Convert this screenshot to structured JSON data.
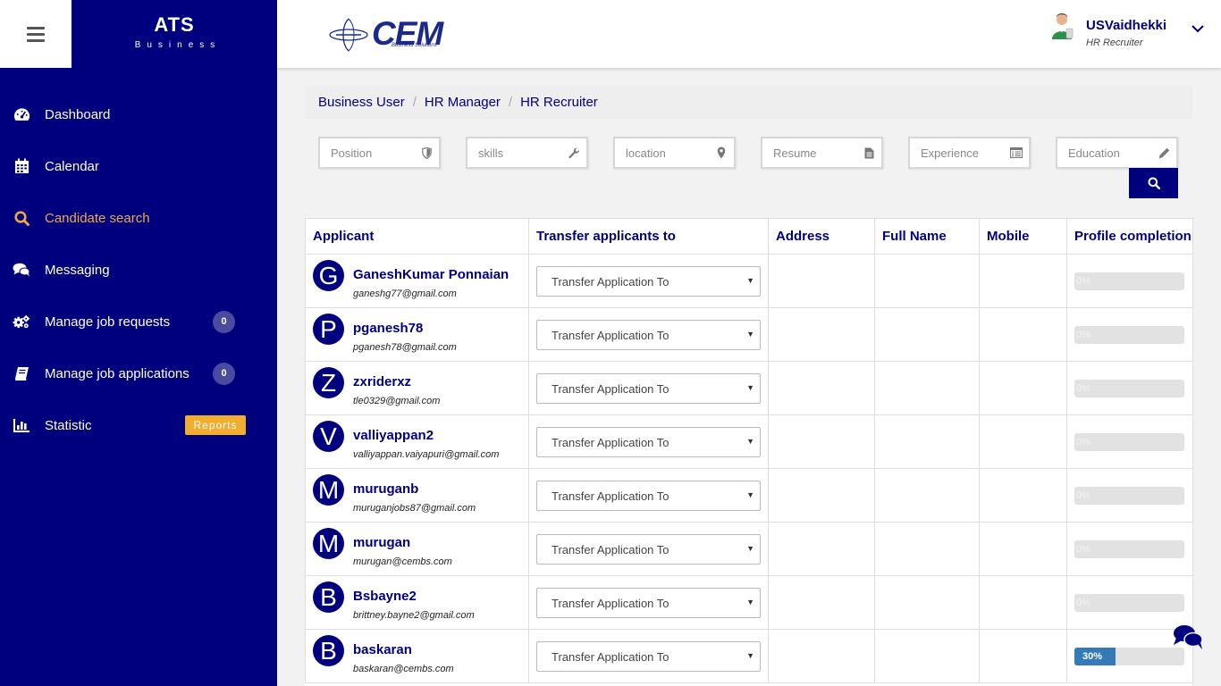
{
  "brand": {
    "title": "ATS",
    "subtitle": "Business"
  },
  "logo": {
    "text": "CEM",
    "sub": "Business Solutions"
  },
  "user": {
    "name": "USVaidhekki",
    "role": "HR Recruiter"
  },
  "sidebar": {
    "items": [
      {
        "label": "Dashboard",
        "icon": "dashboard-icon"
      },
      {
        "label": "Calendar",
        "icon": "calendar-icon"
      },
      {
        "label": "Candidate search",
        "icon": "search-icon",
        "active": true
      },
      {
        "label": "Messaging",
        "icon": "comments-icon"
      },
      {
        "label": "Manage job requests",
        "icon": "gears-icon",
        "badge": "0"
      },
      {
        "label": "Manage job applications",
        "icon": "book-icon",
        "badge": "0"
      },
      {
        "label": "Statistic",
        "icon": "bar-chart-icon",
        "badge": "Reports"
      }
    ]
  },
  "breadcrumb": [
    "Business User",
    "HR Manager",
    "HR Recruiter"
  ],
  "filters": {
    "position": "Position",
    "skills": "skills",
    "location": "location",
    "resume": "Resume",
    "experience": "Experience",
    "education": "Education"
  },
  "table": {
    "headers": [
      "Applicant",
      "Transfer applicants to",
      "Address",
      "Full Name",
      "Mobile",
      "Profile completion"
    ],
    "transfer_placeholder": "Transfer Application To",
    "rows": [
      {
        "initial": "G",
        "name": "GaneshKumar Ponnaian",
        "email": "ganeshg77@gmail.com",
        "address": "",
        "full_name": "",
        "mobile": "",
        "completion": 0,
        "completion_label": "0%"
      },
      {
        "initial": "P",
        "name": "pganesh78",
        "email": "pganesh78@gmail.com",
        "address": "",
        "full_name": "",
        "mobile": "",
        "completion": 0,
        "completion_label": "0%"
      },
      {
        "initial": "Z",
        "name": "zxriderxz",
        "email": "tle0329@gmail.com",
        "address": "",
        "full_name": "",
        "mobile": "",
        "completion": 0,
        "completion_label": "0%"
      },
      {
        "initial": "V",
        "name": "valliyappan2",
        "email": "valliyappan.vaiyapuri@gmail.com",
        "address": "",
        "full_name": "",
        "mobile": "",
        "completion": 0,
        "completion_label": "0%"
      },
      {
        "initial": "M",
        "name": "muruganb",
        "email": "muruganjobs87@gmail.com",
        "address": "",
        "full_name": "",
        "mobile": "",
        "completion": 0,
        "completion_label": "0%"
      },
      {
        "initial": "M",
        "name": "murugan",
        "email": "murugan@cembs.com",
        "address": "",
        "full_name": "",
        "mobile": "",
        "completion": 0,
        "completion_label": "0%"
      },
      {
        "initial": "B",
        "name": "Bsbayne2",
        "email": "brittney.bayne2@gmail.com",
        "address": "",
        "full_name": "",
        "mobile": "",
        "completion": 0,
        "completion_label": "0%"
      },
      {
        "initial": "B",
        "name": "baskaran",
        "email": "baskaran@cembs.com",
        "address": "",
        "full_name": "",
        "mobile": "",
        "completion": 30,
        "completion_label": "30%"
      }
    ]
  },
  "colors": {
    "primary": "#00007f",
    "active": "#f0a844",
    "reports_badge": "#f0ad2e",
    "progress": "#337ab7"
  }
}
